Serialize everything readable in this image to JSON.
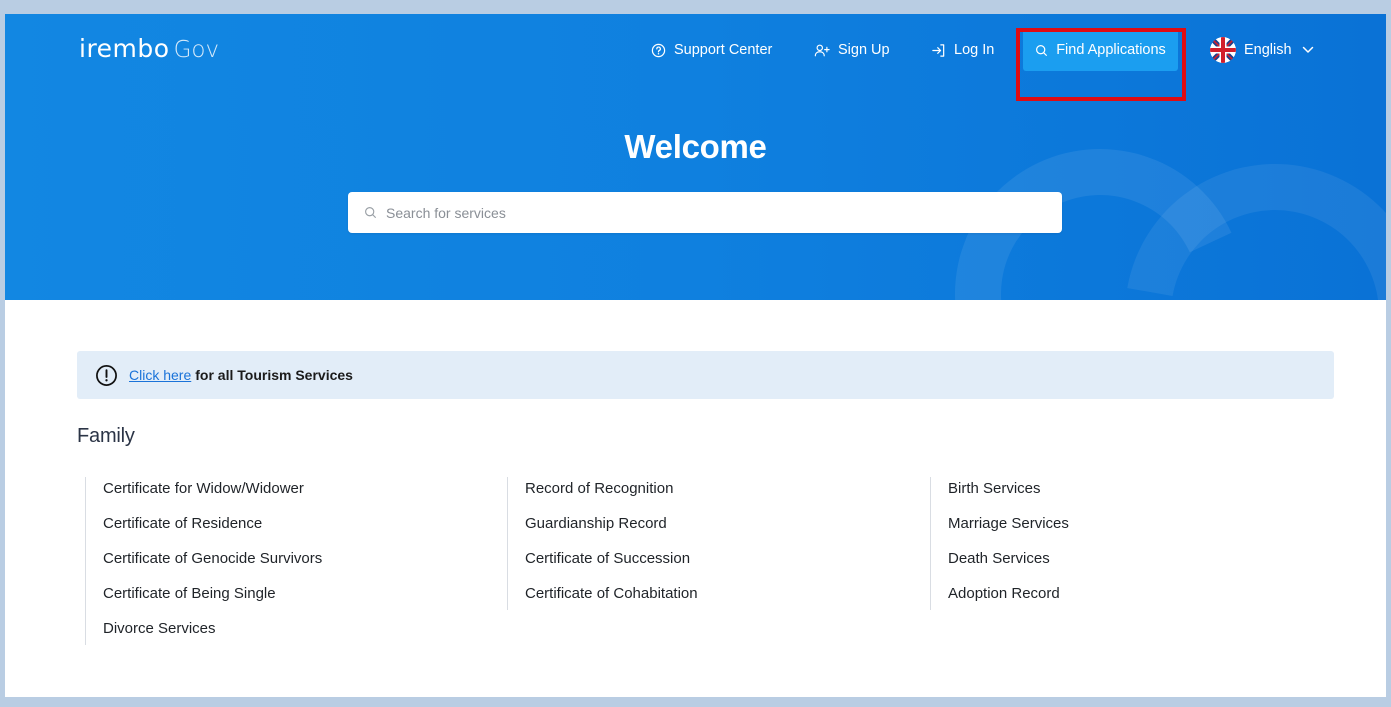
{
  "header": {
    "logo_brand": "irembo",
    "logo_suffix": "Gov",
    "nav": {
      "support": "Support Center",
      "signup": "Sign Up",
      "login": "Log In",
      "find": "Find Applications",
      "language": "English"
    }
  },
  "hero": {
    "title": "Welcome",
    "search_placeholder": "Search for services"
  },
  "notice": {
    "link_text": "Click here",
    "text": "for all Tourism Services"
  },
  "section": {
    "title": "Family",
    "columns": [
      [
        "Certificate for Widow/Widower",
        "Certificate of Residence",
        "Certificate of Genocide Survivors",
        "Certificate of Being Single",
        "Divorce Services"
      ],
      [
        "Record of Recognition",
        "Guardianship Record",
        "Certificate of Succession",
        "Certificate of Cohabitation"
      ],
      [
        "Birth Services",
        "Marriage Services",
        "Death Services",
        "Adoption Record"
      ]
    ]
  },
  "colors": {
    "hero_blue": "#0f80df",
    "find_button": "#1b9ef0",
    "highlight": "#e00b12",
    "notice_bg": "#e2edf8",
    "link": "#1a73d9"
  },
  "icons": [
    "help-circle-icon",
    "user-plus-icon",
    "log-in-icon",
    "search-icon",
    "uk-flag-icon",
    "chevron-down-icon",
    "alert-circle-icon"
  ]
}
